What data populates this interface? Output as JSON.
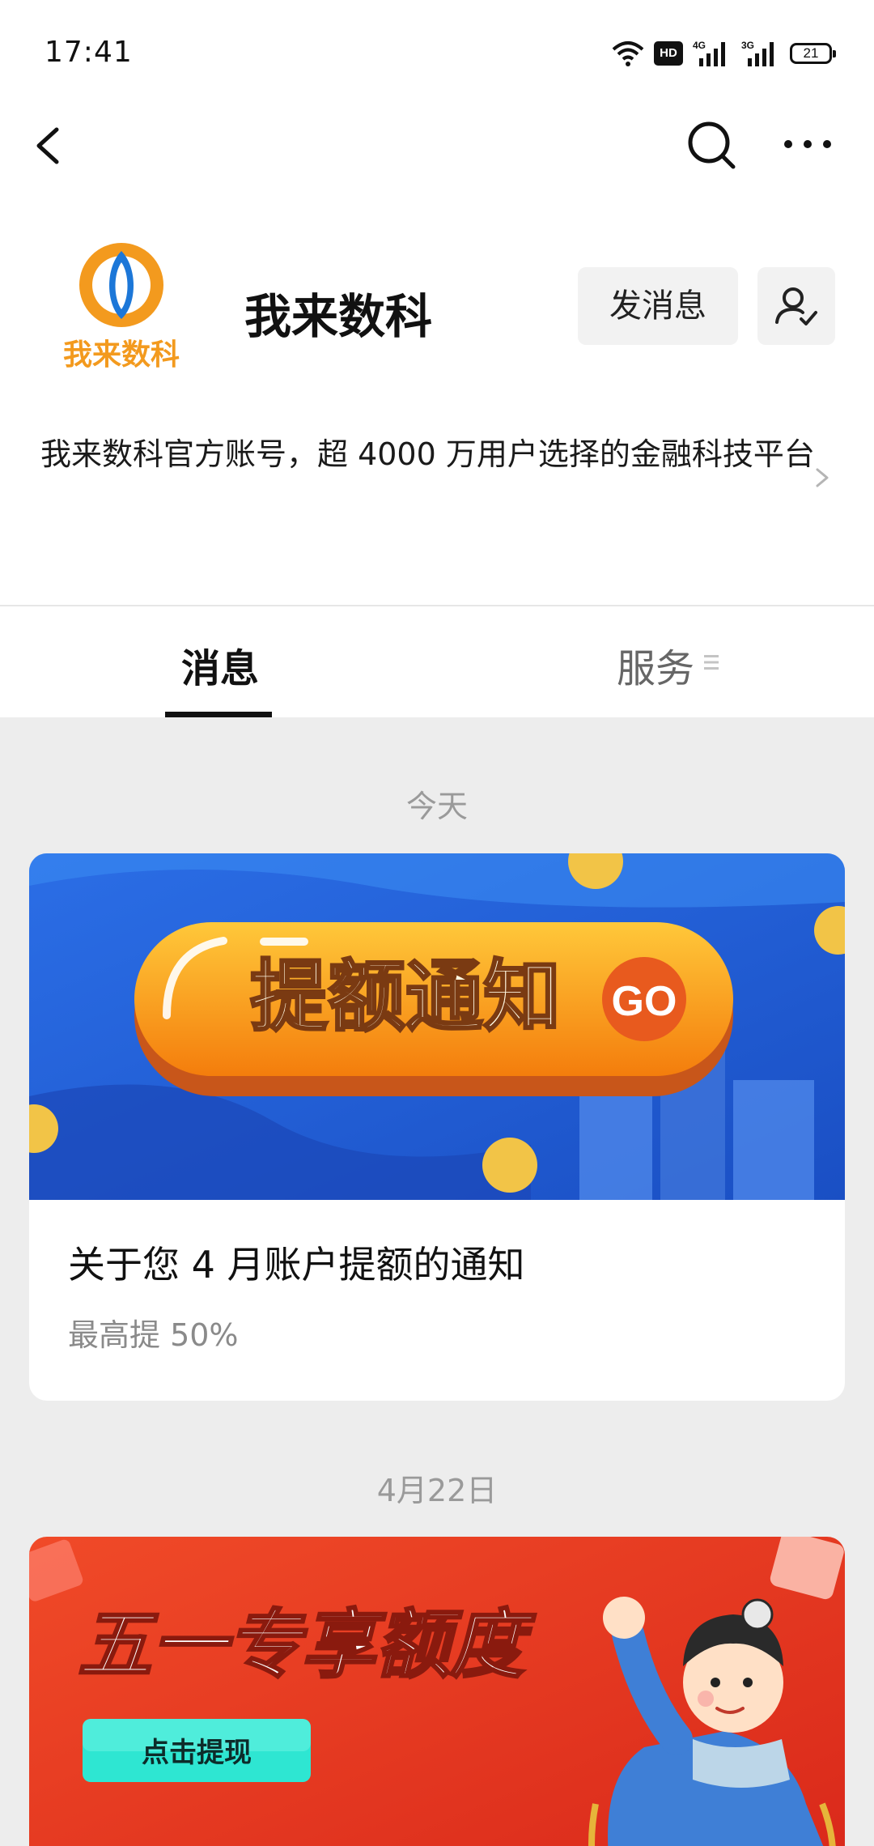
{
  "status_bar": {
    "time": "17:41",
    "icons": [
      "wifi-icon",
      "hd-icon",
      "signal-4g-icon",
      "signal-3g-icon",
      "battery-icon"
    ],
    "hd_label": "HD",
    "net_4g": "4G",
    "net_3g": "3G",
    "battery_level": "21"
  },
  "nav": {
    "back_icon": "chevron-left-icon",
    "search_icon": "search-icon",
    "more_icon": "more-icon"
  },
  "profile": {
    "logo_text": "我来数科",
    "name": "我来数科",
    "message_button": "发消息",
    "description": "我来数科官方账号，超 4000 万用户选择的金融科技平台"
  },
  "tabs": [
    {
      "label": "消息",
      "active": true
    },
    {
      "label": "服务",
      "active": false
    }
  ],
  "feed": [
    {
      "date": "今天",
      "banner_text": "提额通知",
      "banner_go": "GO",
      "title": "关于您 4 月账户提额的通知",
      "subtitle": "最高提 50%"
    },
    {
      "date": "4月22日",
      "banner_text": "五一专享额度",
      "banner_button": "点击提现"
    }
  ],
  "colors": {
    "accent_orange": "#f39a1e",
    "brand_blue": "#1c77d8",
    "banner2_red": "#e83a22",
    "tab_active": "#111111",
    "background": "#ededed"
  }
}
